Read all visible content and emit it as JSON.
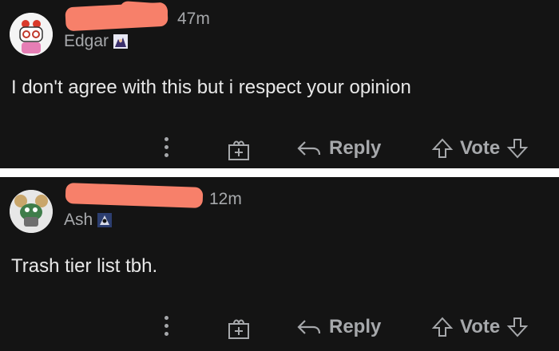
{
  "comments": [
    {
      "time": "47m",
      "flair": "Edgar",
      "text": "I don't agree with this but i respect your opinion",
      "actions": {
        "reply": "Reply",
        "vote": "Vote"
      }
    },
    {
      "time": "12m",
      "flair": "Ash",
      "text": "Trash tier list tbh.",
      "actions": {
        "reply": "Reply",
        "vote": "Vote"
      }
    }
  ],
  "colors": {
    "background": "#141414",
    "text": "#e8e8e8",
    "muted": "#a6a8ab",
    "redaction": "#f7806a",
    "divider": "#ffffff"
  },
  "icons": [
    "more-options-icon",
    "gift-award-icon",
    "reply-arrow-icon",
    "upvote-arrow-icon",
    "downvote-arrow-icon"
  ]
}
